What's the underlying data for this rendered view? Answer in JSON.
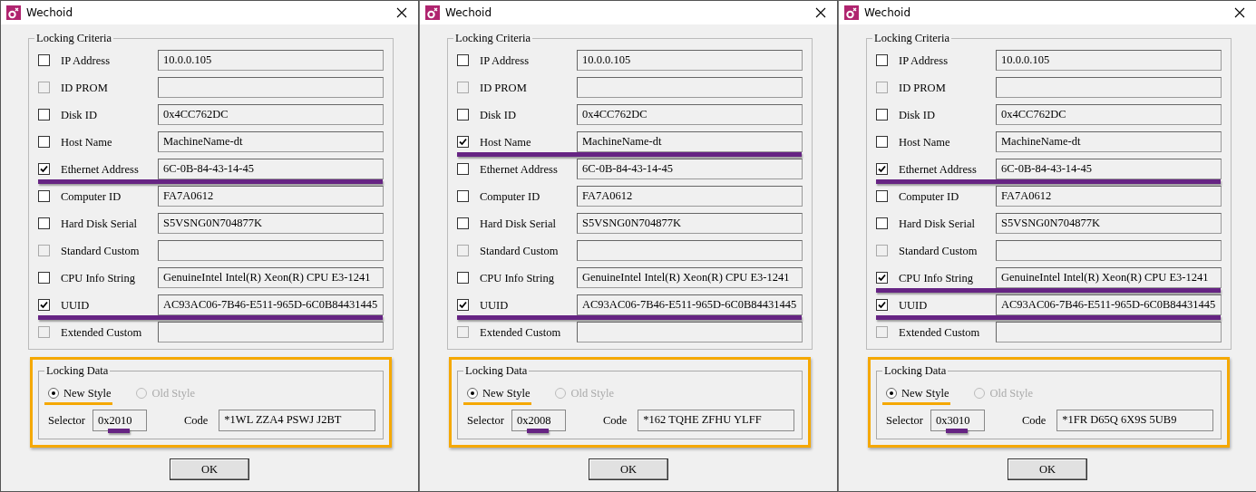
{
  "windows": [
    {
      "title": "Wechoid",
      "criteria_title": "Locking Criteria",
      "criteria": [
        {
          "label": "IP Address",
          "value": "10.0.0.105",
          "checked": false,
          "disabled": false,
          "highlighted": false
        },
        {
          "label": "ID PROM",
          "checked": false,
          "disabled": true,
          "highlighted": false
        },
        {
          "label": "Disk ID",
          "value": "0x4CC762DC",
          "checked": false,
          "disabled": false,
          "highlighted": false
        },
        {
          "label": "Host Name",
          "value": "MachineName-dt",
          "checked": false,
          "disabled": false,
          "highlighted": false
        },
        {
          "label": "Ethernet Address",
          "value": "6C-0B-84-43-14-45",
          "checked": true,
          "disabled": false,
          "highlighted": true
        },
        {
          "label": "Computer ID",
          "value": "FA7A0612",
          "checked": false,
          "disabled": false,
          "highlighted": false
        },
        {
          "label": "Hard Disk Serial",
          "value": "S5VSNG0N704877K",
          "checked": false,
          "disabled": false,
          "highlighted": false
        },
        {
          "label": "Standard Custom",
          "checked": false,
          "disabled": true,
          "highlighted": false
        },
        {
          "label": "CPU Info String",
          "value": "GenuineIntel Intel(R) Xeon(R) CPU E3-1241",
          "checked": false,
          "disabled": false,
          "highlighted": false
        },
        {
          "label": "UUID",
          "value": "AC93AC06-7B46-E511-965D-6C0B84431445",
          "checked": true,
          "disabled": false,
          "highlighted": true
        },
        {
          "label": "Extended Custom",
          "checked": false,
          "disabled": true,
          "highlighted": false
        }
      ],
      "locking_data": {
        "title": "Locking Data",
        "styles": [
          {
            "label": "New Style",
            "selected": true,
            "disabled": false
          },
          {
            "label": "Old Style",
            "selected": false,
            "disabled": true
          }
        ],
        "selector_label": "Selector",
        "selector": "0x2010",
        "code_label": "Code",
        "code": "*1WL ZZA4 PSWJ J2BT"
      },
      "ok": "OK"
    },
    {
      "title": "Wechoid",
      "criteria_title": "Locking Criteria",
      "criteria": [
        {
          "label": "IP Address",
          "value": "10.0.0.105",
          "checked": false,
          "disabled": false,
          "highlighted": false
        },
        {
          "label": "ID PROM",
          "checked": false,
          "disabled": true,
          "highlighted": false
        },
        {
          "label": "Disk ID",
          "value": "0x4CC762DC",
          "checked": false,
          "disabled": false,
          "highlighted": false
        },
        {
          "label": "Host Name",
          "value": "MachineName-dt",
          "checked": true,
          "disabled": false,
          "highlighted": true
        },
        {
          "label": "Ethernet Address",
          "value": "6C-0B-84-43-14-45",
          "checked": false,
          "disabled": false,
          "highlighted": false
        },
        {
          "label": "Computer ID",
          "value": "FA7A0612",
          "checked": false,
          "disabled": false,
          "highlighted": false
        },
        {
          "label": "Hard Disk Serial",
          "value": "S5VSNG0N704877K",
          "checked": false,
          "disabled": false,
          "highlighted": false
        },
        {
          "label": "Standard Custom",
          "checked": false,
          "disabled": true,
          "highlighted": false
        },
        {
          "label": "CPU Info String",
          "value": "GenuineIntel Intel(R) Xeon(R) CPU E3-1241",
          "checked": false,
          "disabled": false,
          "highlighted": false
        },
        {
          "label": "UUID",
          "value": "AC93AC06-7B46-E511-965D-6C0B84431445",
          "checked": true,
          "disabled": false,
          "highlighted": true
        },
        {
          "label": "Extended Custom",
          "checked": false,
          "disabled": true,
          "highlighted": false
        }
      ],
      "locking_data": {
        "title": "Locking Data",
        "styles": [
          {
            "label": "New Style",
            "selected": true,
            "disabled": false
          },
          {
            "label": "Old Style",
            "selected": false,
            "disabled": true
          }
        ],
        "selector_label": "Selector",
        "selector": "0x2008",
        "code_label": "Code",
        "code": "*162 TQHE ZFHU YLFF"
      },
      "ok": "OK"
    },
    {
      "title": "Wechoid",
      "criteria_title": "Locking Criteria",
      "criteria": [
        {
          "label": "IP Address",
          "value": "10.0.0.105",
          "checked": false,
          "disabled": false,
          "highlighted": false
        },
        {
          "label": "ID PROM",
          "checked": false,
          "disabled": true,
          "highlighted": false
        },
        {
          "label": "Disk ID",
          "value": "0x4CC762DC",
          "checked": false,
          "disabled": false,
          "highlighted": false
        },
        {
          "label": "Host Name",
          "value": "MachineName-dt",
          "checked": false,
          "disabled": false,
          "highlighted": false
        },
        {
          "label": "Ethernet Address",
          "value": "6C-0B-84-43-14-45",
          "checked": true,
          "disabled": false,
          "highlighted": true
        },
        {
          "label": "Computer ID",
          "value": "FA7A0612",
          "checked": false,
          "disabled": false,
          "highlighted": false
        },
        {
          "label": "Hard Disk Serial",
          "value": "S5VSNG0N704877K",
          "checked": false,
          "disabled": false,
          "highlighted": false
        },
        {
          "label": "Standard Custom",
          "checked": false,
          "disabled": true,
          "highlighted": false
        },
        {
          "label": "CPU Info String",
          "value": "GenuineIntel Intel(R) Xeon(R) CPU E3-1241",
          "checked": true,
          "disabled": false,
          "highlighted": true
        },
        {
          "label": "UUID",
          "value": "AC93AC06-7B46-E511-965D-6C0B84431445",
          "checked": true,
          "disabled": false,
          "highlighted": true
        },
        {
          "label": "Extended Custom",
          "checked": false,
          "disabled": true,
          "highlighted": false
        }
      ],
      "locking_data": {
        "title": "Locking Data",
        "styles": [
          {
            "label": "New Style",
            "selected": true,
            "disabled": false
          },
          {
            "label": "Old Style",
            "selected": false,
            "disabled": true
          }
        ],
        "selector_label": "Selector",
        "selector": "0x3010",
        "code_label": "Code",
        "code": "*1FR D65Q 6X9S 5UB9"
      },
      "ok": "OK"
    }
  ]
}
